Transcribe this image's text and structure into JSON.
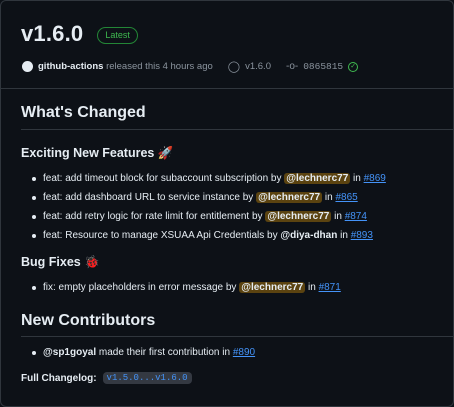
{
  "release": {
    "title": "v1.6.0",
    "badge": "Latest",
    "author": "github-actions",
    "released_text": "released this 4 hours ago",
    "tag": "v1.6.0",
    "commit": "0865815"
  },
  "whats_changed": "What's Changed",
  "features": {
    "heading": "Exciting New Features 🚀",
    "items": [
      {
        "text": "feat: add timeout block for subaccount subscription by ",
        "user": "@lechnerc77",
        "in": " in ",
        "pr": "#869"
      },
      {
        "text": "feat: add dashboard URL to service instance by ",
        "user": "@lechnerc77",
        "in": " in ",
        "pr": "#865"
      },
      {
        "text": "feat: add retry logic for rate limit for entitlement by ",
        "user": "@lechnerc77",
        "in": " in ",
        "pr": "#874"
      },
      {
        "text": "feat: Resource to manage XSUAA Api Credentials by ",
        "user": "@diya-dhan",
        "in": " in ",
        "pr": "#893"
      }
    ]
  },
  "bugfixes": {
    "heading": "Bug Fixes 🐞",
    "items": [
      {
        "text": "fix: empty placeholders in error message by ",
        "user": "@lechnerc77",
        "in": " in ",
        "pr": "#871"
      }
    ]
  },
  "contributors": {
    "heading": "New Contributors",
    "items": [
      {
        "user": "@sp1goyal",
        "text": " made their first contribution in ",
        "pr": "#890"
      }
    ]
  },
  "changelog": {
    "label": "Full Changelog:",
    "range": "v1.5.0...v1.6.0"
  },
  "colors": {
    "background": "#0d1117",
    "link": "#4493f8",
    "success": "#3fb950",
    "mention_highlight": "#bb8009"
  },
  "icons": [
    "github-logo-icon",
    "tag-icon",
    "commit-icon",
    "check-circle-icon"
  ]
}
